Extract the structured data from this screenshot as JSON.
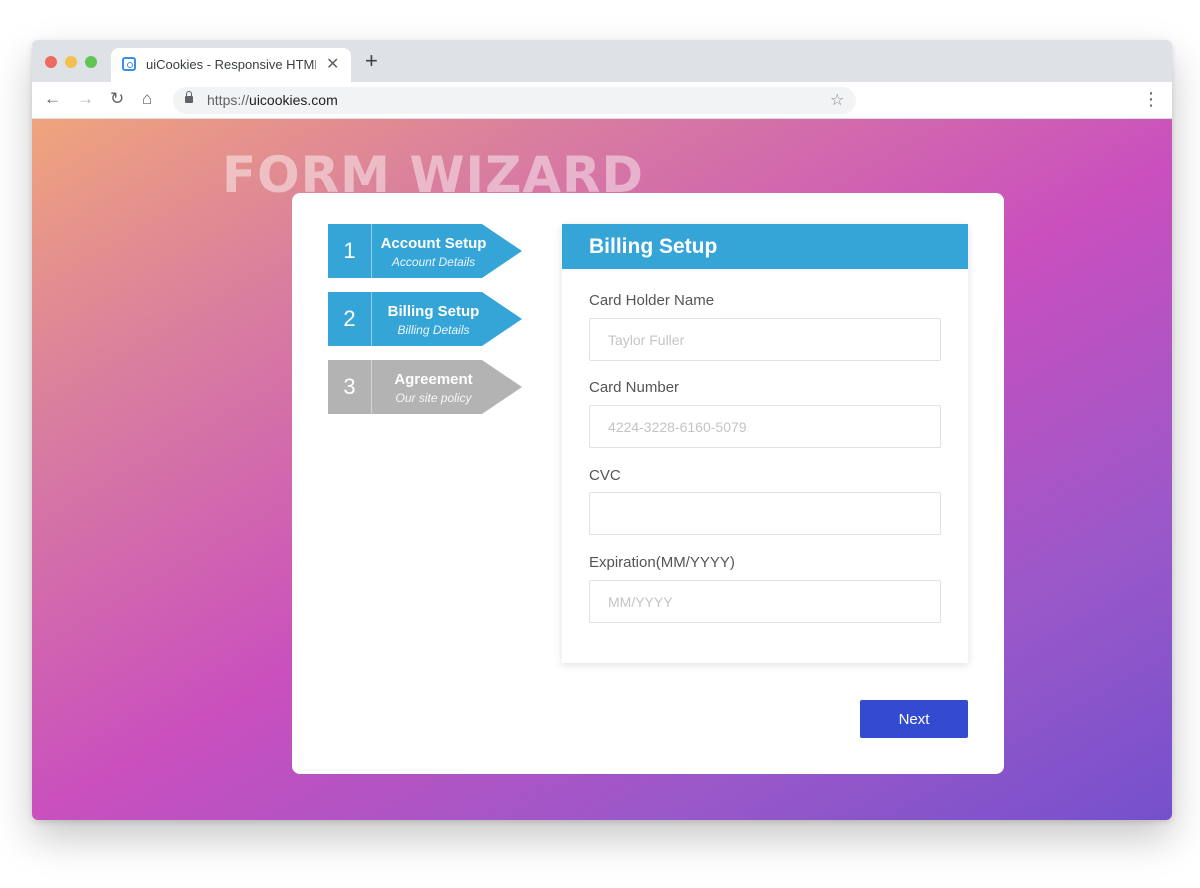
{
  "browser": {
    "tab_title": "uiCookies - Responsive HTML",
    "tab_close": "✕",
    "new_tab": "+",
    "url_scheme": "https://",
    "url_host": "uicookies.com",
    "icons": [
      "back-arrow-icon",
      "forward-arrow-icon",
      "reload-icon",
      "home-icon",
      "lock-icon",
      "star-icon",
      "menu-icon"
    ]
  },
  "page": {
    "hero_title": "FORM WIZARD",
    "background_colors": [
      "#f0a47c",
      "#c94fbe",
      "#7550cc"
    ]
  },
  "steps": [
    {
      "number": "1",
      "title": "Account Setup",
      "subtitle": "Account Details",
      "state": "done",
      "color": "#35a5d8"
    },
    {
      "number": "2",
      "title": "Billing Setup",
      "subtitle": "Billing Details",
      "state": "current",
      "color": "#35a5d8"
    },
    {
      "number": "3",
      "title": "Agreement",
      "subtitle": "Our site policy",
      "state": "inactive",
      "color": "#b3b3b3"
    }
  ],
  "form": {
    "title": "Billing Setup",
    "header_color": "#35a5d8",
    "fields": [
      {
        "label": "Card Holder Name",
        "value": "",
        "placeholder": "Taylor Fuller"
      },
      {
        "label": "Card Number",
        "value": "",
        "placeholder": "4224-3228-6160-5079"
      },
      {
        "label": "CVC",
        "value": "",
        "placeholder": ""
      },
      {
        "label": "Expiration(MM/YYYY)",
        "value": "",
        "placeholder": "MM/YYYY"
      }
    ],
    "next_label": "Next",
    "next_color": "#334bd0"
  }
}
